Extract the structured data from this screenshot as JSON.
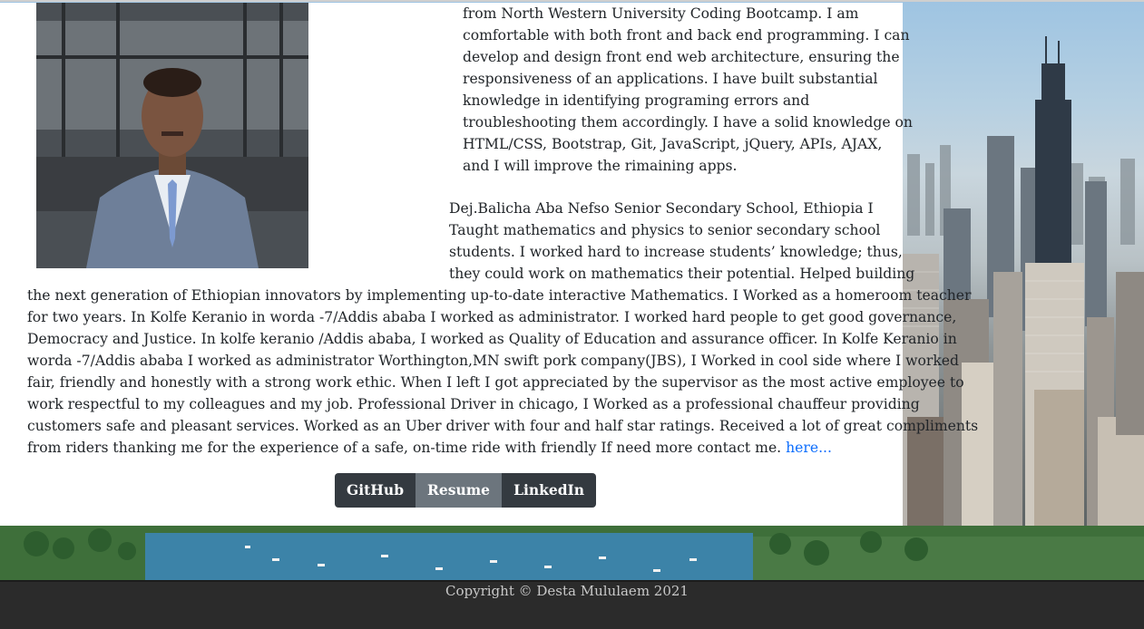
{
  "about": {
    "intro_lines": [
      "from North Western University Coding Bootcamp. I am",
      "comfortable with both front and back end programming. I can",
      "develop and design front end web architecture, ensuring the",
      "responsiveness of an applications. I have built substantial",
      "knowledge in identifying programing errors and",
      "troubleshooting them accordingly. I have a solid knowledge on",
      "HTML/CSS, Bootstrap, Git, JavaScript, jQuery, APIs, AJAX,",
      "and I will improve the rimaining apps."
    ],
    "experience_lines": [
      "Dej.Balicha Aba Nefso Senior Secondary School, Ethiopia I",
      "Taught mathematics and physics to senior secondary school",
      "students. I worked hard to increase students’ knowledge; thus,",
      "they could work on mathematics their potential. Helped building",
      "the next generation of Ethiopian innovators by implementing up-to-date interactive Mathematics. I Worked as a homeroom teacher",
      "for two years. In Kolfe Keranio in worda -7/Addis ababa I worked as administrator. I worked hard people to get good governance,",
      "Democracy and Justice. In kolfe keranio /Addis ababa, I worked as Quality of Education and assurance officer. In Kolfe Keranio in",
      "worda -7/Addis ababa I worked as administrator Worthington,MN swift pork company(JBS), I Worked in cool side where I worked",
      "fair, friendly and honestly with a strong work ethic. When I left I got appreciated by the supervisor as the most active employee to",
      "work respectful to my colleagues and my job. Professional Driver in chicago, I Worked as a professional chauffeur providing",
      "customers safe and pleasant services. Worked as an Uber driver with four and half star ratings. Received a lot of great compliments"
    ],
    "last_line": "from riders thanking me for the experience of a safe, on-time ride with friendly If need more contact me.",
    "link_label": "here..."
  },
  "buttons": {
    "github": "GitHub",
    "resume": "Resume",
    "linkedin": "LinkedIn"
  },
  "footer": {
    "copyright": "Copyright © Desta Mululaem 2021"
  },
  "colors": {
    "button_dark": "#343a40",
    "button_active": "#6c757d",
    "link": "#0d6efd",
    "footer_bg": "#2b2b2b"
  }
}
